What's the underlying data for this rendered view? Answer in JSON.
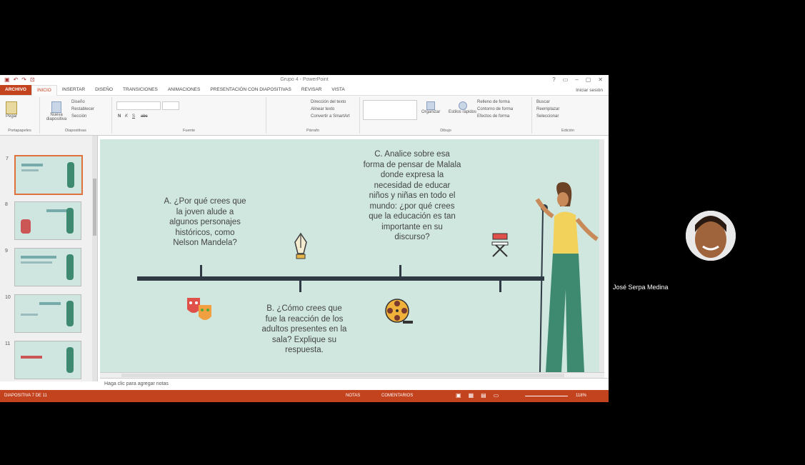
{
  "app": {
    "window_title": "Grupo 4 - PowerPoint",
    "signin": "Iniciar sesión",
    "quick_access": [
      "▣",
      "↶",
      "↷",
      "⊡"
    ],
    "window_controls": [
      "?",
      "▭",
      "–",
      "▢",
      "✕"
    ]
  },
  "ribbon": {
    "tabs": [
      "ARCHIVO",
      "INICIO",
      "INSERTAR",
      "DISEÑO",
      "TRANSICIONES",
      "ANIMACIONES",
      "PRESENTACIÓN CON DIAPOSITIVAS",
      "REVISAR",
      "VISTA"
    ],
    "active_tab_index": 1,
    "groups": [
      {
        "label": "Portapapeles",
        "buttons": [
          "Pegar"
        ]
      },
      {
        "label": "Diapositivas",
        "buttons": [
          "Nueva diapositiva",
          "Diseño",
          "Restablecer",
          "Sección"
        ]
      },
      {
        "label": "Fuente",
        "buttons": [
          "N",
          "K",
          "S",
          "abc"
        ]
      },
      {
        "label": "Párrafo",
        "buttons": [
          "Dirección del texto",
          "Alinear texto",
          "Convertir a SmartArt"
        ]
      },
      {
        "label": "Dibujo",
        "buttons": [
          "Organizar",
          "Estilos rápidos",
          "Relleno de forma",
          "Contorno de forma",
          "Efectos de forma"
        ]
      },
      {
        "label": "Edición",
        "buttons": [
          "Buscar",
          "Reemplazar",
          "Seleccionar"
        ]
      }
    ]
  },
  "thumbnails": [
    {
      "number": "7",
      "selected": true
    },
    {
      "number": "8",
      "selected": false
    },
    {
      "number": "9",
      "selected": false
    },
    {
      "number": "10",
      "selected": false
    },
    {
      "number": "11",
      "selected": false
    }
  ],
  "slide": {
    "question_a": "A. ¿Por qué crees que\nla joven alude a\nalgunos personajes\nhistóricos, como\nNelson Mandela?",
    "question_b": "B. ¿Cómo crees que\nfue la reacción de los\nadultos presentes en la\nsala? Explique su\nrespuesta.",
    "question_c": "C. Analice sobre esa\nforma de pensar de Malala\ndonde expresa la\nnecesidad de educar\nniños y niñas en todo el\nmundo: ¿por qué crees\nque la educación es tan\nimportante en su\ndiscurso?",
    "icons": [
      "pen-nib-icon",
      "theater-masks-icon",
      "film-reel-icon",
      "director-chair-icon"
    ]
  },
  "notes": {
    "placeholder": "Haga clic para agregar notas"
  },
  "status": {
    "slide_counter": "DIAPOSITIVA 7 DE 11",
    "notes_label": "NOTAS",
    "comments_label": "COMENTARIOS",
    "zoom": "118%"
  },
  "participant": {
    "name": "José Serpa Medina"
  },
  "colors": {
    "accent": "#c4431f",
    "slide_bg": "#cfe7df",
    "timeline": "#2f3a44"
  }
}
